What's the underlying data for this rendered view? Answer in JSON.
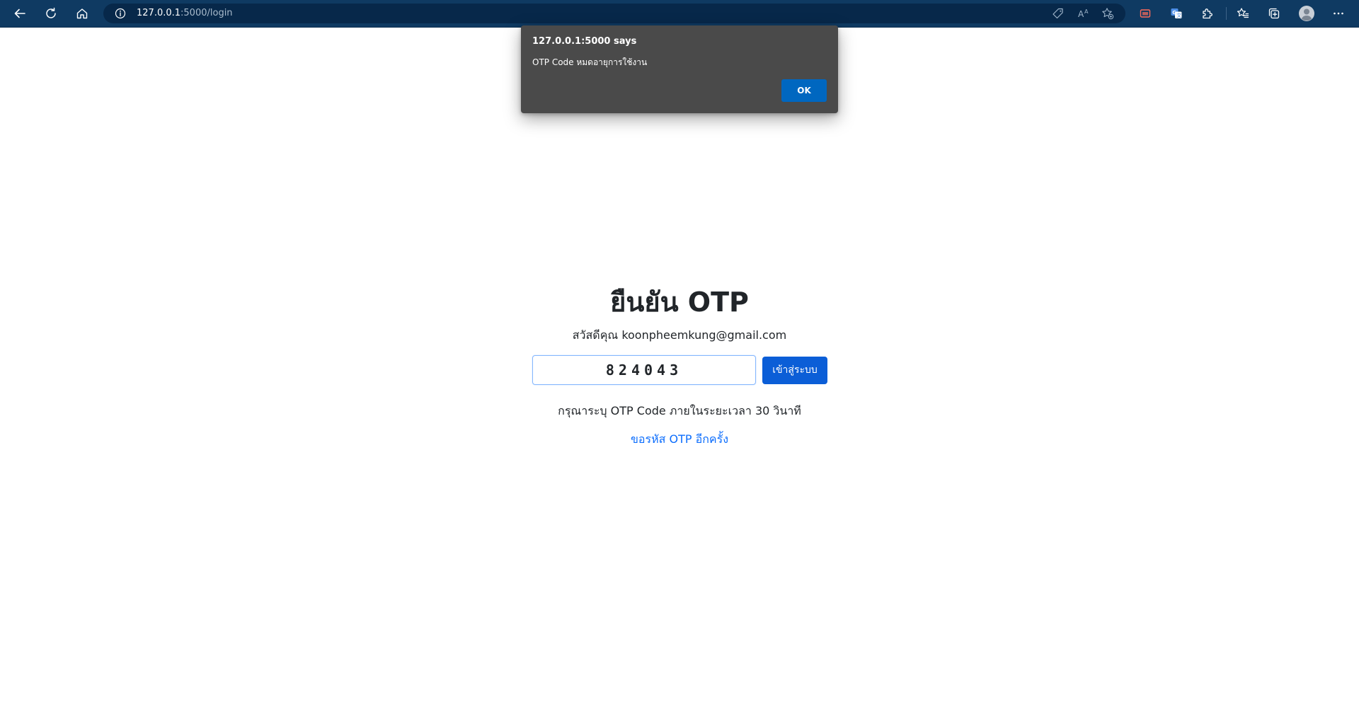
{
  "browser": {
    "url_host": "127.0.0.1",
    "url_path": ":5000/login",
    "icons": {
      "back": "back-arrow-icon",
      "refresh": "refresh-icon",
      "home": "home-icon",
      "site_info": "info-icon",
      "tag": "tag-icon",
      "read_aloud": "read-aloud-icon",
      "favorite": "add-favorite-icon",
      "collections_toolbar": "screenshot-icon",
      "translate": "translate-icon",
      "extensions": "extensions-icon",
      "favorites": "favorites-icon",
      "collections": "collections-icon",
      "profile": "profile-avatar-icon",
      "more": "more-icon"
    }
  },
  "page": {
    "title": "ยืนยัน OTP",
    "greeting": "สวัสดีคุณ koonpheemkung@gmail.com",
    "otp_value": "824043",
    "login_label": "เข้าสู่ระบบ",
    "hint": "กรุณาระบุ OTP Code ภายในระยะเวลา 30 วินาที",
    "resend_label": "ขอรหัส OTP อีกครั้ง"
  },
  "alert": {
    "title": "127.0.0.1:5000 says",
    "message": "OTP Code หมดอายุการใช้งาน",
    "ok_label": "OK"
  },
  "colors": {
    "toolbar_bg": "#0f3a62",
    "address_bg": "#07284a",
    "primary": "#0b5ed7",
    "link": "#0d6efd",
    "alert_bg": "#4a4a4a",
    "alert_button": "#0067c0"
  }
}
